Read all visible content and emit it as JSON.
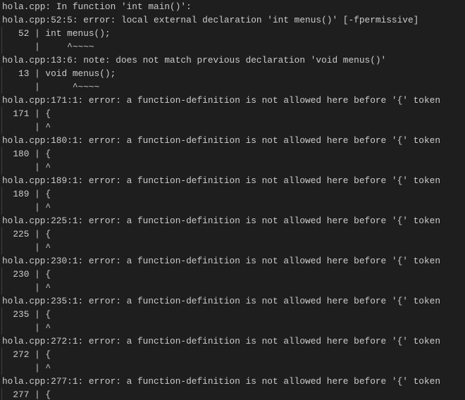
{
  "terminal": {
    "colors": {
      "background": "#1e1e1e",
      "text": "#cccccc"
    },
    "lines": [
      "hola.cpp: In function 'int main()':",
      "hola.cpp:52:5: error: local external declaration 'int menus()' [-fpermissive]",
      "   52 | int menus();",
      "      |     ^~~~~",
      "hola.cpp:13:6: note: does not match previous declaration 'void menus()'",
      "   13 | void menus();",
      "      |      ^~~~~",
      "hola.cpp:171:1: error: a function-definition is not allowed here before '{' token",
      "  171 | {",
      "      | ^",
      "hola.cpp:180:1: error: a function-definition is not allowed here before '{' token",
      "  180 | {",
      "      | ^",
      "hola.cpp:189:1: error: a function-definition is not allowed here before '{' token",
      "  189 | {",
      "      | ^",
      "hola.cpp:225:1: error: a function-definition is not allowed here before '{' token",
      "  225 | {",
      "      | ^",
      "hola.cpp:230:1: error: a function-definition is not allowed here before '{' token",
      "  230 | {",
      "      | ^",
      "hola.cpp:235:1: error: a function-definition is not allowed here before '{' token",
      "  235 | {",
      "      | ^",
      "hola.cpp:272:1: error: a function-definition is not allowed here before '{' token",
      "  272 | {",
      "      | ^",
      "hola.cpp:277:1: error: a function-definition is not allowed here before '{' token",
      "  277 | {"
    ]
  }
}
